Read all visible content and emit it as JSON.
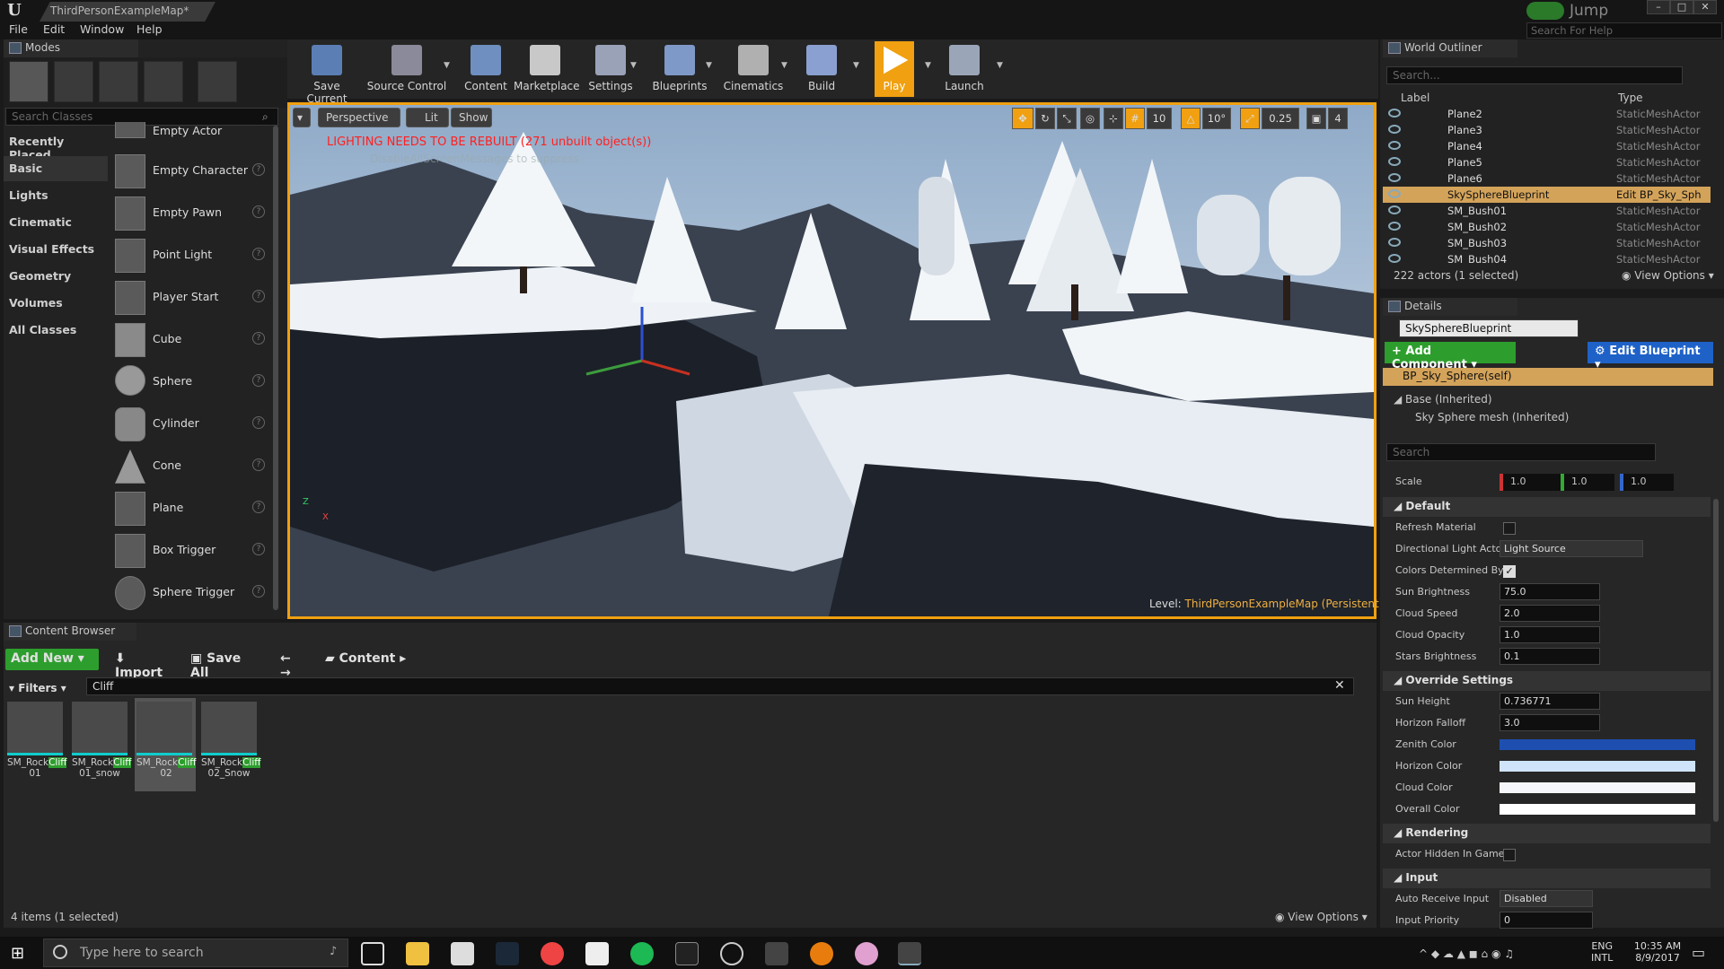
{
  "title_tab": "ThirdPersonExampleMap*",
  "jump_label": "Jump",
  "menu": [
    "File",
    "Edit",
    "Window",
    "Help"
  ],
  "help_search": "Search For Help",
  "modes": {
    "title": "Modes",
    "search_placeholder": "Search Classes",
    "categories": [
      "Recently Placed",
      "Basic",
      "Lights",
      "Cinematic",
      "Visual Effects",
      "Geometry",
      "Volumes",
      "All Classes"
    ],
    "items": [
      "Empty Actor",
      "Empty Character",
      "Empty Pawn",
      "Point Light",
      "Player Start",
      "Cube",
      "Sphere",
      "Cylinder",
      "Cone",
      "Plane",
      "Box Trigger",
      "Sphere Trigger"
    ]
  },
  "toolbar": [
    "Save Current",
    "Source Control",
    "Content",
    "Marketplace",
    "Settings",
    "Blueprints",
    "Cinematics",
    "Build",
    "Play",
    "Launch"
  ],
  "viewport": {
    "perspective": "Perspective",
    "lit": "Lit",
    "show": "Show",
    "warning": "LIGHTING NEEDS TO BE REBUILT (271 unbuilt object(s))",
    "warning2": "DisableAllScreenMessages to suppress",
    "level_label": "Level:",
    "level_name": "ThirdPersonExampleMap (Persistent)",
    "grid": "10",
    "rot": "10°",
    "scale": "0.25",
    "cam": "4"
  },
  "content_browser": {
    "title": "Content Browser",
    "add_new": "Add New",
    "import": "Import",
    "save_all": "Save All",
    "path": "Content",
    "filters": "Filters",
    "search": "Cliff",
    "assets": [
      {
        "a": "SM_Rock",
        "b": "Cliff",
        "c": "01"
      },
      {
        "a": "SM_Rock",
        "b": "Cliff",
        "c": "01_snow"
      },
      {
        "a": "SM_Rock",
        "b": "Cliff",
        "c": "02"
      },
      {
        "a": "SM_Rock",
        "b": "Cliff",
        "c": "02_Snow"
      }
    ],
    "status": "4 items (1 selected)",
    "view_options": "View Options"
  },
  "outliner": {
    "title": "World Outliner",
    "search": "Search...",
    "col_label": "Label",
    "col_type": "Type",
    "rows": [
      {
        "n": "Plane2",
        "t": "StaticMeshActor"
      },
      {
        "n": "Plane3",
        "t": "StaticMeshActor"
      },
      {
        "n": "Plane4",
        "t": "StaticMeshActor"
      },
      {
        "n": "Plane5",
        "t": "StaticMeshActor"
      },
      {
        "n": "Plane6",
        "t": "StaticMeshActor"
      },
      {
        "n": "SkySphereBlueprint",
        "t": "Edit BP_Sky_Sph"
      },
      {
        "n": "SM_Bush01",
        "t": "StaticMeshActor"
      },
      {
        "n": "SM_Bush02",
        "t": "StaticMeshActor"
      },
      {
        "n": "SM_Bush03",
        "t": "StaticMeshActor"
      },
      {
        "n": "SM_Bush04",
        "t": "StaticMeshActor"
      }
    ],
    "status": "222 actors (1 selected)",
    "view_options": "View Options"
  },
  "details": {
    "title": "Details",
    "name": "SkySphereBlueprint",
    "add_component": "Add Component",
    "edit_blueprint": "Edit Blueprint",
    "self": "BP_Sky_Sphere(self)",
    "base": "Base (Inherited)",
    "mesh": "Sky Sphere mesh (Inherited)",
    "search": "Search",
    "scale_label": "Scale",
    "sx": "1.0",
    "sy": "1.0",
    "sz": "1.0",
    "sec_default": "Default",
    "refresh": "Refresh Material",
    "dir_light": "Directional Light Acto",
    "dir_light_val": "Light Source",
    "colors_det": "Colors Determined By",
    "sun_b": "Sun Brightness",
    "sun_b_v": "75.0",
    "cloud_s": "Cloud Speed",
    "cloud_s_v": "2.0",
    "cloud_o": "Cloud Opacity",
    "cloud_o_v": "1.0",
    "stars": "Stars Brightness",
    "stars_v": "0.1",
    "sec_override": "Override Settings",
    "sun_h": "Sun Height",
    "sun_h_v": "0.736771",
    "horizon_f": "Horizon Falloff",
    "horizon_f_v": "3.0",
    "zenith": "Zenith Color",
    "horizon_c": "Horizon Color",
    "cloud_c": "Cloud Color",
    "overall": "Overall Color",
    "sec_render": "Rendering",
    "actor_hidden": "Actor Hidden In Game",
    "sec_input": "Input",
    "auto_input": "Auto Receive Input",
    "auto_input_v": "Disabled",
    "input_pri": "Input Priority",
    "input_pri_v": "0"
  },
  "taskbar": {
    "search": "Type here to search",
    "lang1": "ENG",
    "lang2": "INTL",
    "time": "10:35 AM",
    "date": "8/9/2017"
  },
  "colors": {
    "accent": "#f0a010",
    "select": "#d3a35a",
    "green": "#2d9e2d",
    "blue": "#1e62c8"
  }
}
